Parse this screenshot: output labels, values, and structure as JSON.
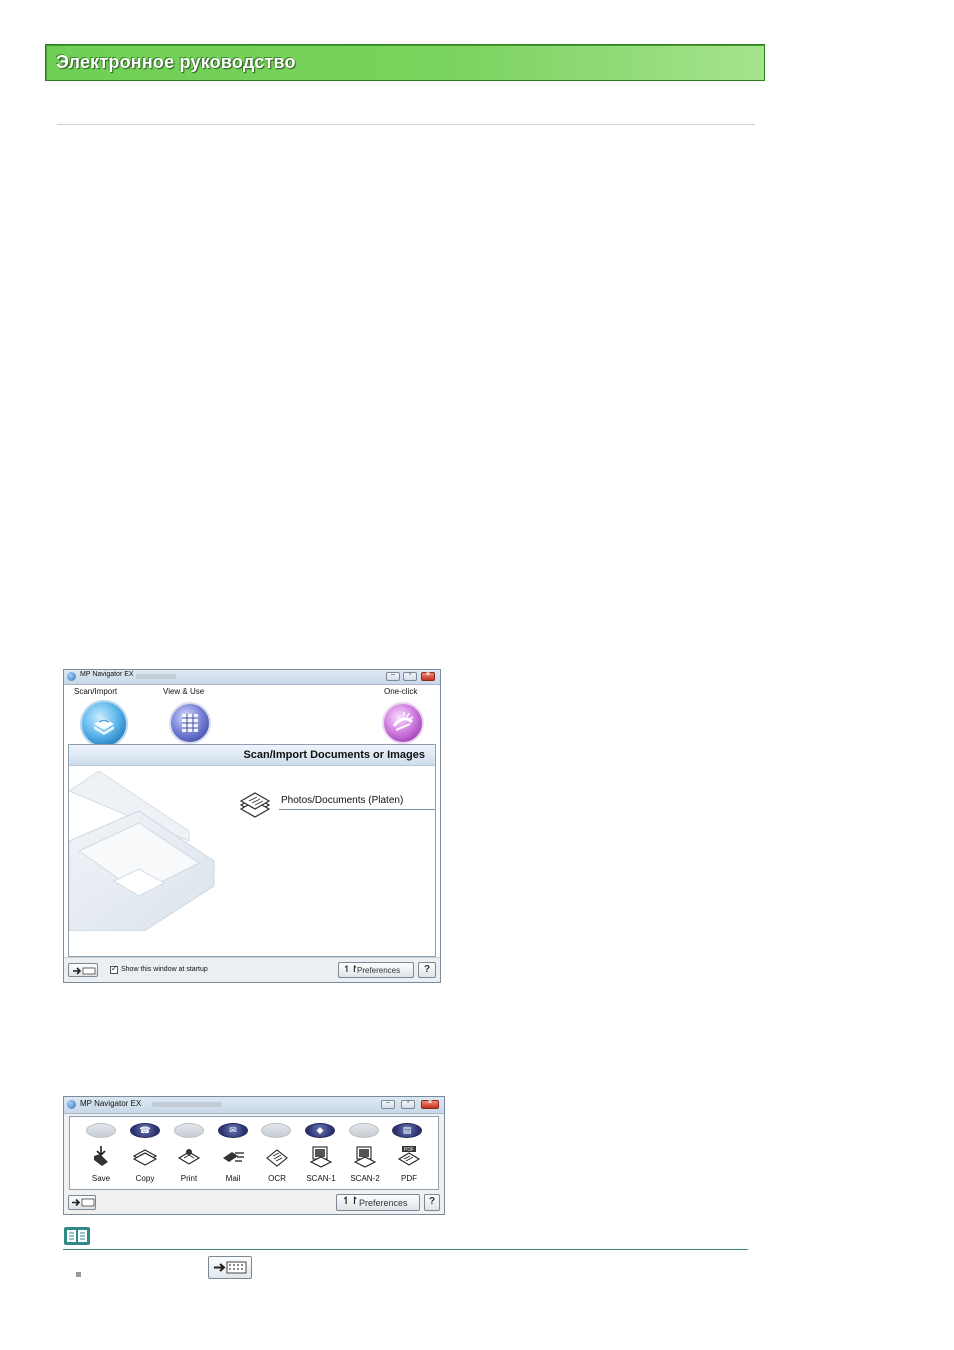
{
  "header": {
    "title": "Электронное руководство"
  },
  "window1": {
    "title": "MP Navigator EX",
    "modes": [
      {
        "label": "Scan/Import",
        "icon": "scanner-icon"
      },
      {
        "label": "View & Use",
        "icon": "grid-icon"
      },
      {
        "label": "One-click",
        "icon": "one-click-icon"
      }
    ],
    "panel_title": "Scan/Import Documents or Images",
    "item_label": "Photos/Documents (Platen)",
    "startup_checkbox": {
      "label": "Show this window at startup",
      "checked": true
    },
    "preferences_label": "Preferences",
    "help_label": "?"
  },
  "window2": {
    "title": "MP Navigator EX",
    "functions": [
      {
        "label": "Save",
        "icon": "save-icon"
      },
      {
        "label": "Copy",
        "icon": "copy-icon"
      },
      {
        "label": "Print",
        "icon": "print-icon"
      },
      {
        "label": "Mail",
        "icon": "mail-icon"
      },
      {
        "label": "OCR",
        "icon": "ocr-icon"
      },
      {
        "label": "SCAN-1",
        "icon": "scan1-icon"
      },
      {
        "label": "SCAN-2",
        "icon": "scan2-icon"
      },
      {
        "label": "PDF",
        "icon": "pdf-icon"
      }
    ],
    "preferences_label": "Preferences",
    "help_label": "?"
  },
  "colors": {
    "banner": "#6fcf55",
    "note_rule": "#3e8a78"
  }
}
